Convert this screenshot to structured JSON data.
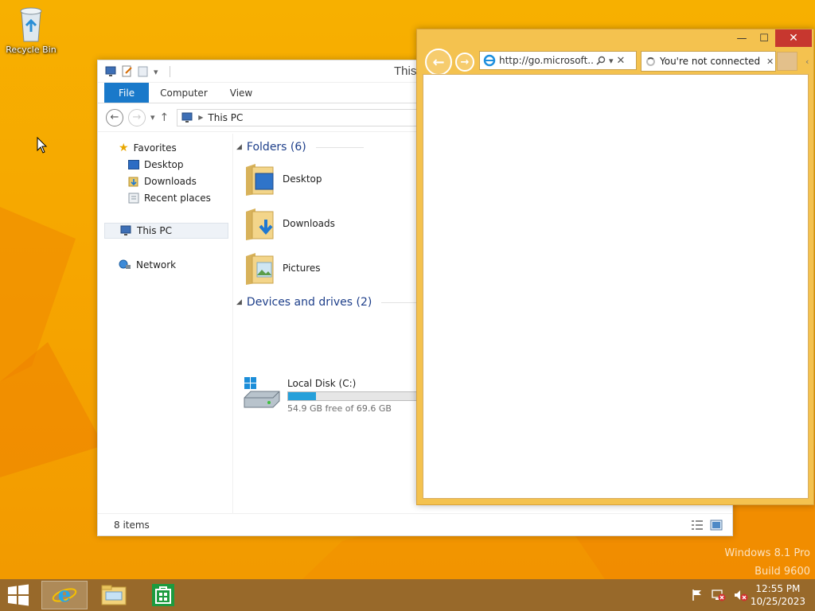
{
  "desktop": {
    "recycle_bin_label": "Recycle Bin",
    "watermark_line1": "Windows 8.1 Pro",
    "watermark_line2": "Build 9600"
  },
  "explorer": {
    "title": "This",
    "ribbon_tabs": [
      "File",
      "Computer",
      "View"
    ],
    "address_crumb": "This PC",
    "nav": {
      "favorites": "Favorites",
      "desktop": "Desktop",
      "downloads": "Downloads",
      "recent_places": "Recent places",
      "this_pc": "This PC",
      "network": "Network"
    },
    "folders_header": "Folders (6)",
    "folders": [
      "Desktop",
      "Downloads",
      "Pictures"
    ],
    "devices_header": "Devices and drives (2)",
    "drive": {
      "name": "Local Disk (C:)",
      "free_text": "54.9 GB free of 69.6 GB",
      "used_fraction": 0.21
    },
    "status_items": "8 items"
  },
  "ie": {
    "address": "http://go.microsoft....",
    "tab_title": "You're not connected ...",
    "minimize_glyph": "—",
    "maximize_glyph": "☐",
    "close_glyph": "✕"
  },
  "taskbar": {
    "time": "12:55 PM",
    "date": "10/25/2023"
  },
  "colors": {
    "ie_frame": "#f4c24f",
    "file_tab": "#1979ca",
    "taskbar": "#98692a",
    "close_button": "#c7372f"
  }
}
